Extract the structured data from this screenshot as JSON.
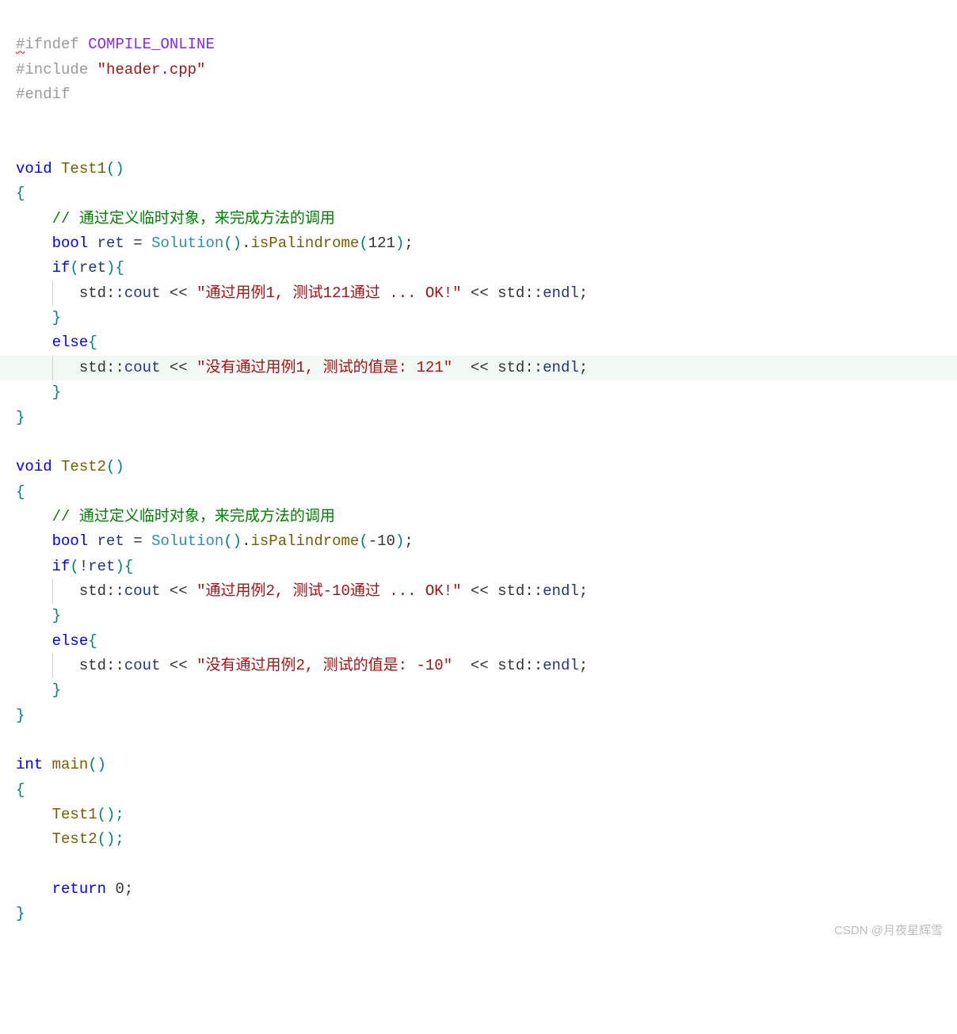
{
  "code": {
    "l1": {
      "pre": "#",
      "kw": "ifndef",
      "macro": "COMPILE_ONLINE"
    },
    "l2": {
      "pre": "#",
      "kw": "include",
      "str": "\"header.cpp\""
    },
    "l3": {
      "pre": "#",
      "kw": "endif"
    },
    "t1": {
      "ret": "void",
      "name": "Test1",
      "parens": "()",
      "comment": "// 通过定义临时对象，来完成方法的调用",
      "decl_type": "bool",
      "decl_var": "ret",
      "eq": " = ",
      "solution": "Solution",
      "paren1": "()",
      "dot": ".",
      "method": "isPalindrome",
      "arg1": "121",
      "if_kw": "if",
      "if_cond": "ret",
      "cout1_ns": "std",
      "cout1_cout": "cout",
      "cout1_op": " << ",
      "cout1_str": "\"通过用例1, 测试121通过 ... OK!\"",
      "cout1_op2": " << ",
      "cout1_endl_ns": "std",
      "cout1_endl": "endl",
      "else_kw": "else",
      "cout2_ns": "std",
      "cout2_cout": "cout",
      "cout2_op": " << ",
      "cout2_str": "\"没有通过用例1, 测试的值是: 121\"",
      "cout2_op2": "  << ",
      "cout2_endl_ns": "std",
      "cout2_endl": "endl"
    },
    "t2": {
      "ret": "void",
      "name": "Test2",
      "parens": "()",
      "comment": "// 通过定义临时对象，来完成方法的调用",
      "decl_type": "bool",
      "decl_var": "ret",
      "eq": " = ",
      "solution": "Solution",
      "paren1": "()",
      "dot": ".",
      "method": "isPalindrome",
      "arg1": "-10",
      "if_kw": "if",
      "if_neg": "!",
      "if_cond": "ret",
      "cout1_ns": "std",
      "cout1_cout": "cout",
      "cout1_op": " << ",
      "cout1_str": "\"通过用例2, 测试-10通过 ... OK!\"",
      "cout1_op2": " << ",
      "cout1_endl_ns": "std",
      "cout1_endl": "endl",
      "else_kw": "else",
      "cout2_ns": "std",
      "cout2_cout": "cout",
      "cout2_op": " << ",
      "cout2_str": "\"没有通过用例2, 测试的值是: -10\"",
      "cout2_op2": "  << ",
      "cout2_endl_ns": "std",
      "cout2_endl": "endl"
    },
    "main": {
      "ret": "int",
      "name": "main",
      "parens": "()",
      "call1": "Test1",
      "call1p": "();",
      "call2": "Test2",
      "call2p": "();",
      "ret_kw": "return",
      "ret_val": "0"
    }
  },
  "watermark": "CSDN @月夜星辉雪"
}
